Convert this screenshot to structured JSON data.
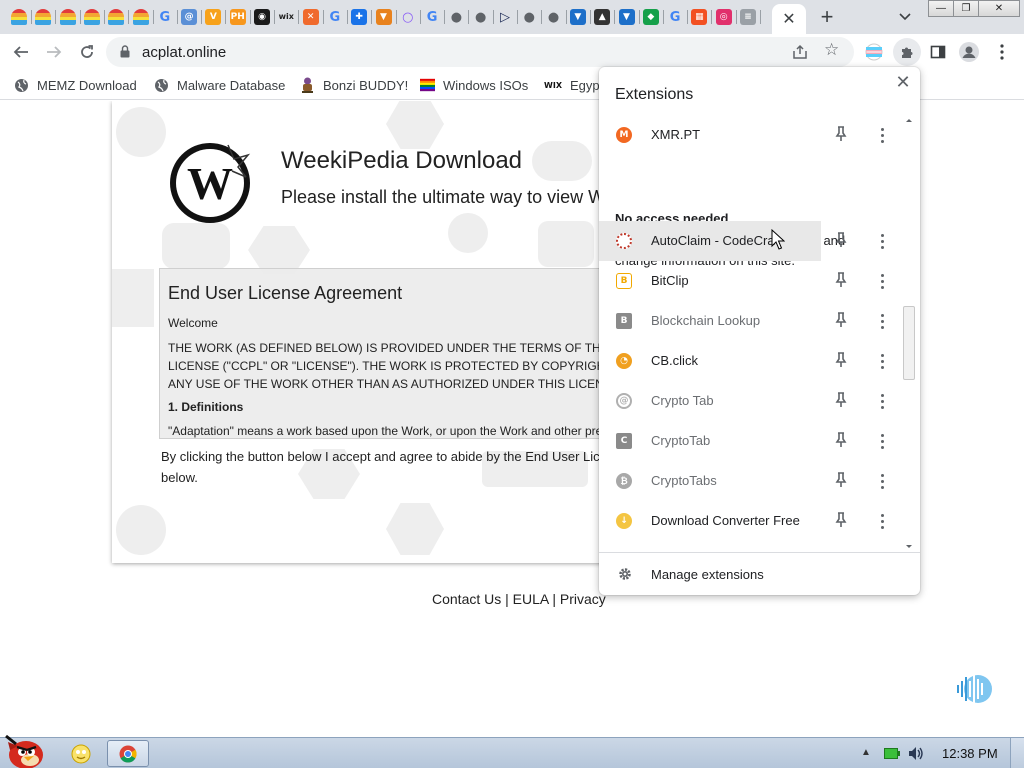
{
  "browser": {
    "tab_favicons": [
      {
        "icon": "rainbow-icon",
        "color": "#e8a33d"
      },
      {
        "icon": "rainbow-icon",
        "color": "#e8a33d"
      },
      {
        "icon": "rainbow-icon",
        "color": "#e8a33d"
      },
      {
        "icon": "rainbow-icon",
        "color": "#e8a33d"
      },
      {
        "icon": "rainbow-icon",
        "color": "#e8a33d"
      },
      {
        "icon": "rainbow-icon",
        "color": "#e8a33d"
      },
      {
        "icon": "google-icon",
        "color": "#4285f4"
      },
      {
        "icon": "spiral-icon",
        "color": "#5a8fd6"
      },
      {
        "icon": "vpnhub-icon",
        "color": "#f7a21b"
      },
      {
        "icon": "ph-icon",
        "color": "#f7971d"
      },
      {
        "icon": "aperture-icon",
        "color": "#1b1b1b"
      },
      {
        "icon": "wix-icon",
        "color": "#222222"
      },
      {
        "icon": "x-mark-icon",
        "color": "#f06a2d"
      },
      {
        "icon": "google-icon",
        "color": "#4285f4"
      },
      {
        "icon": "puzzle-icon",
        "color": "#1a73e8"
      },
      {
        "icon": "fox-icon",
        "color": "#e8821e"
      },
      {
        "icon": "ring-icon",
        "color": "#8a5cf6"
      },
      {
        "icon": "google-icon",
        "color": "#4285f4"
      },
      {
        "icon": "globe-icon",
        "color": "#5f6368"
      },
      {
        "icon": "globe-icon",
        "color": "#5f6368"
      },
      {
        "icon": "play-icon",
        "color": "#1c2a55"
      },
      {
        "icon": "globe-icon",
        "color": "#5f6368"
      },
      {
        "icon": "globe-icon",
        "color": "#5f6368"
      },
      {
        "icon": "shield-icon",
        "color": "#1d6fc9"
      },
      {
        "icon": "hat-icon",
        "color": "#333333"
      },
      {
        "icon": "shield-icon",
        "color": "#1d6fc9"
      },
      {
        "icon": "shield-green-icon",
        "color": "#15a04a"
      },
      {
        "icon": "google-icon",
        "color": "#4285f4"
      },
      {
        "icon": "windows-icon",
        "color": "#f25022"
      },
      {
        "icon": "instagram-icon",
        "color": "#e1306c"
      },
      {
        "icon": "document-icon",
        "color": "#9aa0a6"
      }
    ],
    "active_tab_close": "✕",
    "new_tab_label": "+",
    "tab_search_label": "⌄",
    "window_buttons": {
      "minimize": "—",
      "restore": "❐",
      "close": "✕"
    },
    "url": "acplat.online",
    "bookmarks": [
      {
        "label": "MEMZ Download",
        "icon": "globe-icon"
      },
      {
        "label": "Malware Database",
        "icon": "globe-icon"
      },
      {
        "label": "Bonzi BUDDY!",
        "icon": "bonzi-icon"
      },
      {
        "label": "Windows ISOs",
        "icon": "rainbow-flag-icon"
      },
      {
        "label": "Egypt",
        "icon": "wix-icon"
      }
    ]
  },
  "page": {
    "title": "WeekiPedia Download",
    "subtitle": "Please install the ultimate way to view W",
    "eula": {
      "title": "End User License Agreement",
      "welcome": "Welcome",
      "body_lines": [
        "THE WORK (AS DEFINED BELOW) IS PROVIDED UNDER THE TERMS OF TH",
        "LICENSE (\"CCPL\" OR \"LICENSE\"). THE WORK IS PROTECTED BY COPYRIGH",
        "ANY USE OF THE WORK OTHER THAN AS AUTHORIZED UNDER THIS LICEN"
      ],
      "definitions_heading": "1. Definitions",
      "adaptation_line": "\"Adaptation\" means a work based upon the Work, or upon the Work and other pre"
    },
    "agree_lines": [
      "By clicking the button below I accept and agree to abide by the End User Lice",
      "below."
    ],
    "footer": {
      "contact": "Contact Us",
      "sep": "|",
      "eula": "EULA",
      "privacy": "Privacy"
    }
  },
  "extensions_popup": {
    "title": "Extensions",
    "close_label": "✕",
    "pinned_section": [
      {
        "name": "XMR.PT",
        "icon": "monero-icon",
        "color": "#f26822"
      }
    ],
    "no_access_heading": "No access needed",
    "no_access_description": "These extensions don't need to see and change information on this site.",
    "no_access_items": [
      {
        "name": "AutoClaim - CodeCra",
        "icon": "codecrafting-icon",
        "color": "#c0392b",
        "hovered": true,
        "dim": false
      },
      {
        "name": "BitClip",
        "icon": "bitclip-icon",
        "color": "#f2a900",
        "dim": false
      },
      {
        "name": "Blockchain Lookup",
        "icon": "blockchain-b-icon",
        "color": "#8a8a8a",
        "letter": "B",
        "dim": true
      },
      {
        "name": "CB.click",
        "icon": "cbclick-icon",
        "color": "#f0a020",
        "dim": false
      },
      {
        "name": "Crypto Tab",
        "icon": "cryptotab-icon",
        "color": "#b0b0b0",
        "dim": true
      },
      {
        "name": "CryptoTab",
        "icon": "cryptotab-c-icon",
        "color": "#8a8a8a",
        "letter": "C",
        "dim": true
      },
      {
        "name": "CryptoTabs",
        "icon": "bitcoin-grey-icon",
        "color": "#a8a8a8",
        "dim": true
      },
      {
        "name": "Download Converter Free",
        "icon": "download-converter-icon",
        "color": "#f4c542",
        "dim": false
      }
    ],
    "manage_label": "Manage extensions"
  },
  "taskbar": {
    "clock": "12:38 PM",
    "tray_arrow": "▲"
  }
}
